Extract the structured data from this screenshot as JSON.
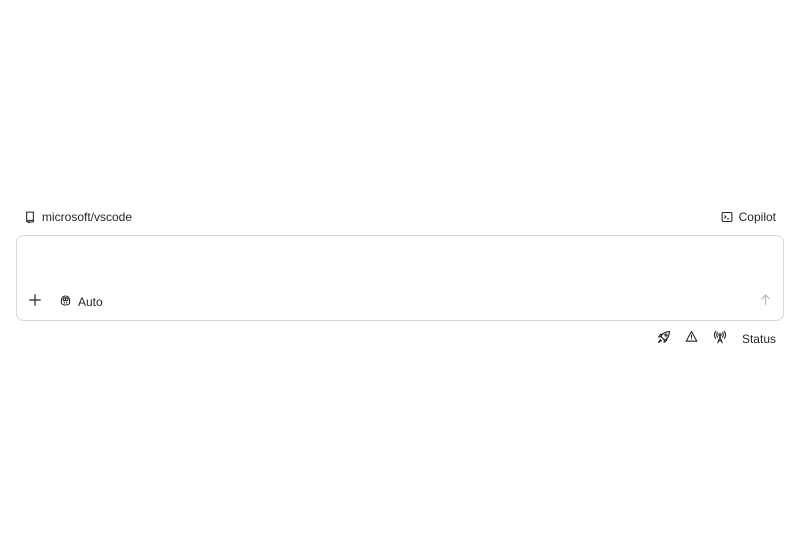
{
  "header": {
    "repo_label": "microsoft/vscode",
    "repo_icon": "repo-icon",
    "mode_label": "Copilot",
    "mode_icon": "terminal-icon"
  },
  "composer": {
    "placeholder": "",
    "value": "",
    "add_icon": "plus-icon",
    "model_label": "Auto",
    "model_icon": "copilot-icon",
    "send_icon": "arrow-up-icon"
  },
  "footer": {
    "icons": [
      "rocket-icon",
      "alert-icon",
      "broadcast-icon"
    ],
    "status_label": "Status"
  },
  "colors": {
    "text": "#1f2328",
    "border": "#d0d7de",
    "muted_icon": "#afb8c1",
    "background": "#ffffff"
  }
}
